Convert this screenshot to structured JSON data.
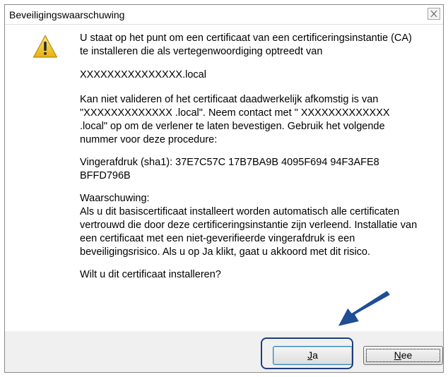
{
  "window": {
    "title": "Beveiligingswaarschuwing",
    "close_symbol": "✕"
  },
  "icons": {
    "warning": "warning-icon",
    "close": "close-icon",
    "pointer_arrow": "arrow-icon"
  },
  "colors": {
    "warning_yellow": "#f0c419",
    "highlight_blue": "#1f3d7a"
  },
  "message": {
    "intro": "U staat op het punt om een certificaat van een certificeringsinstantie (CA) te installeren die als vertegenwoordiging optreedt van",
    "hostname": "XXXXXXXXXXXXXXX.local",
    "validation": "Kan niet valideren of het certificaat daadwerkelijk afkomstig is van \"XXXXXXXXXXXXX .local\". Neem contact met \" XXXXXXXXXXXXX .local\" op om de verlener te laten bevestigen. Gebruik het volgende nummer voor deze procedure:",
    "thumbprint": "Vingerafdruk (sha1): 37E7C57C 17B7BA9B 4095F694 94F3AFE8 BFFD796B",
    "warning_heading": "Waarschuwing:",
    "warning_body": "Als u dit basiscertificaat installeert worden automatisch alle certificaten vertrouwd die door deze certificeringsinstantie zijn verleend. Installatie van een certificaat met een niet-geverifieerde vingerafdruk is een beveiligingsrisico. Als u op Ja klikt, gaat u akkoord met dit risico.",
    "question": "Wilt u dit certificaat installeren?"
  },
  "buttons": {
    "yes_mnemonic": "J",
    "yes_rest": "a",
    "no_mnemonic": "N",
    "no_rest": "ee"
  }
}
